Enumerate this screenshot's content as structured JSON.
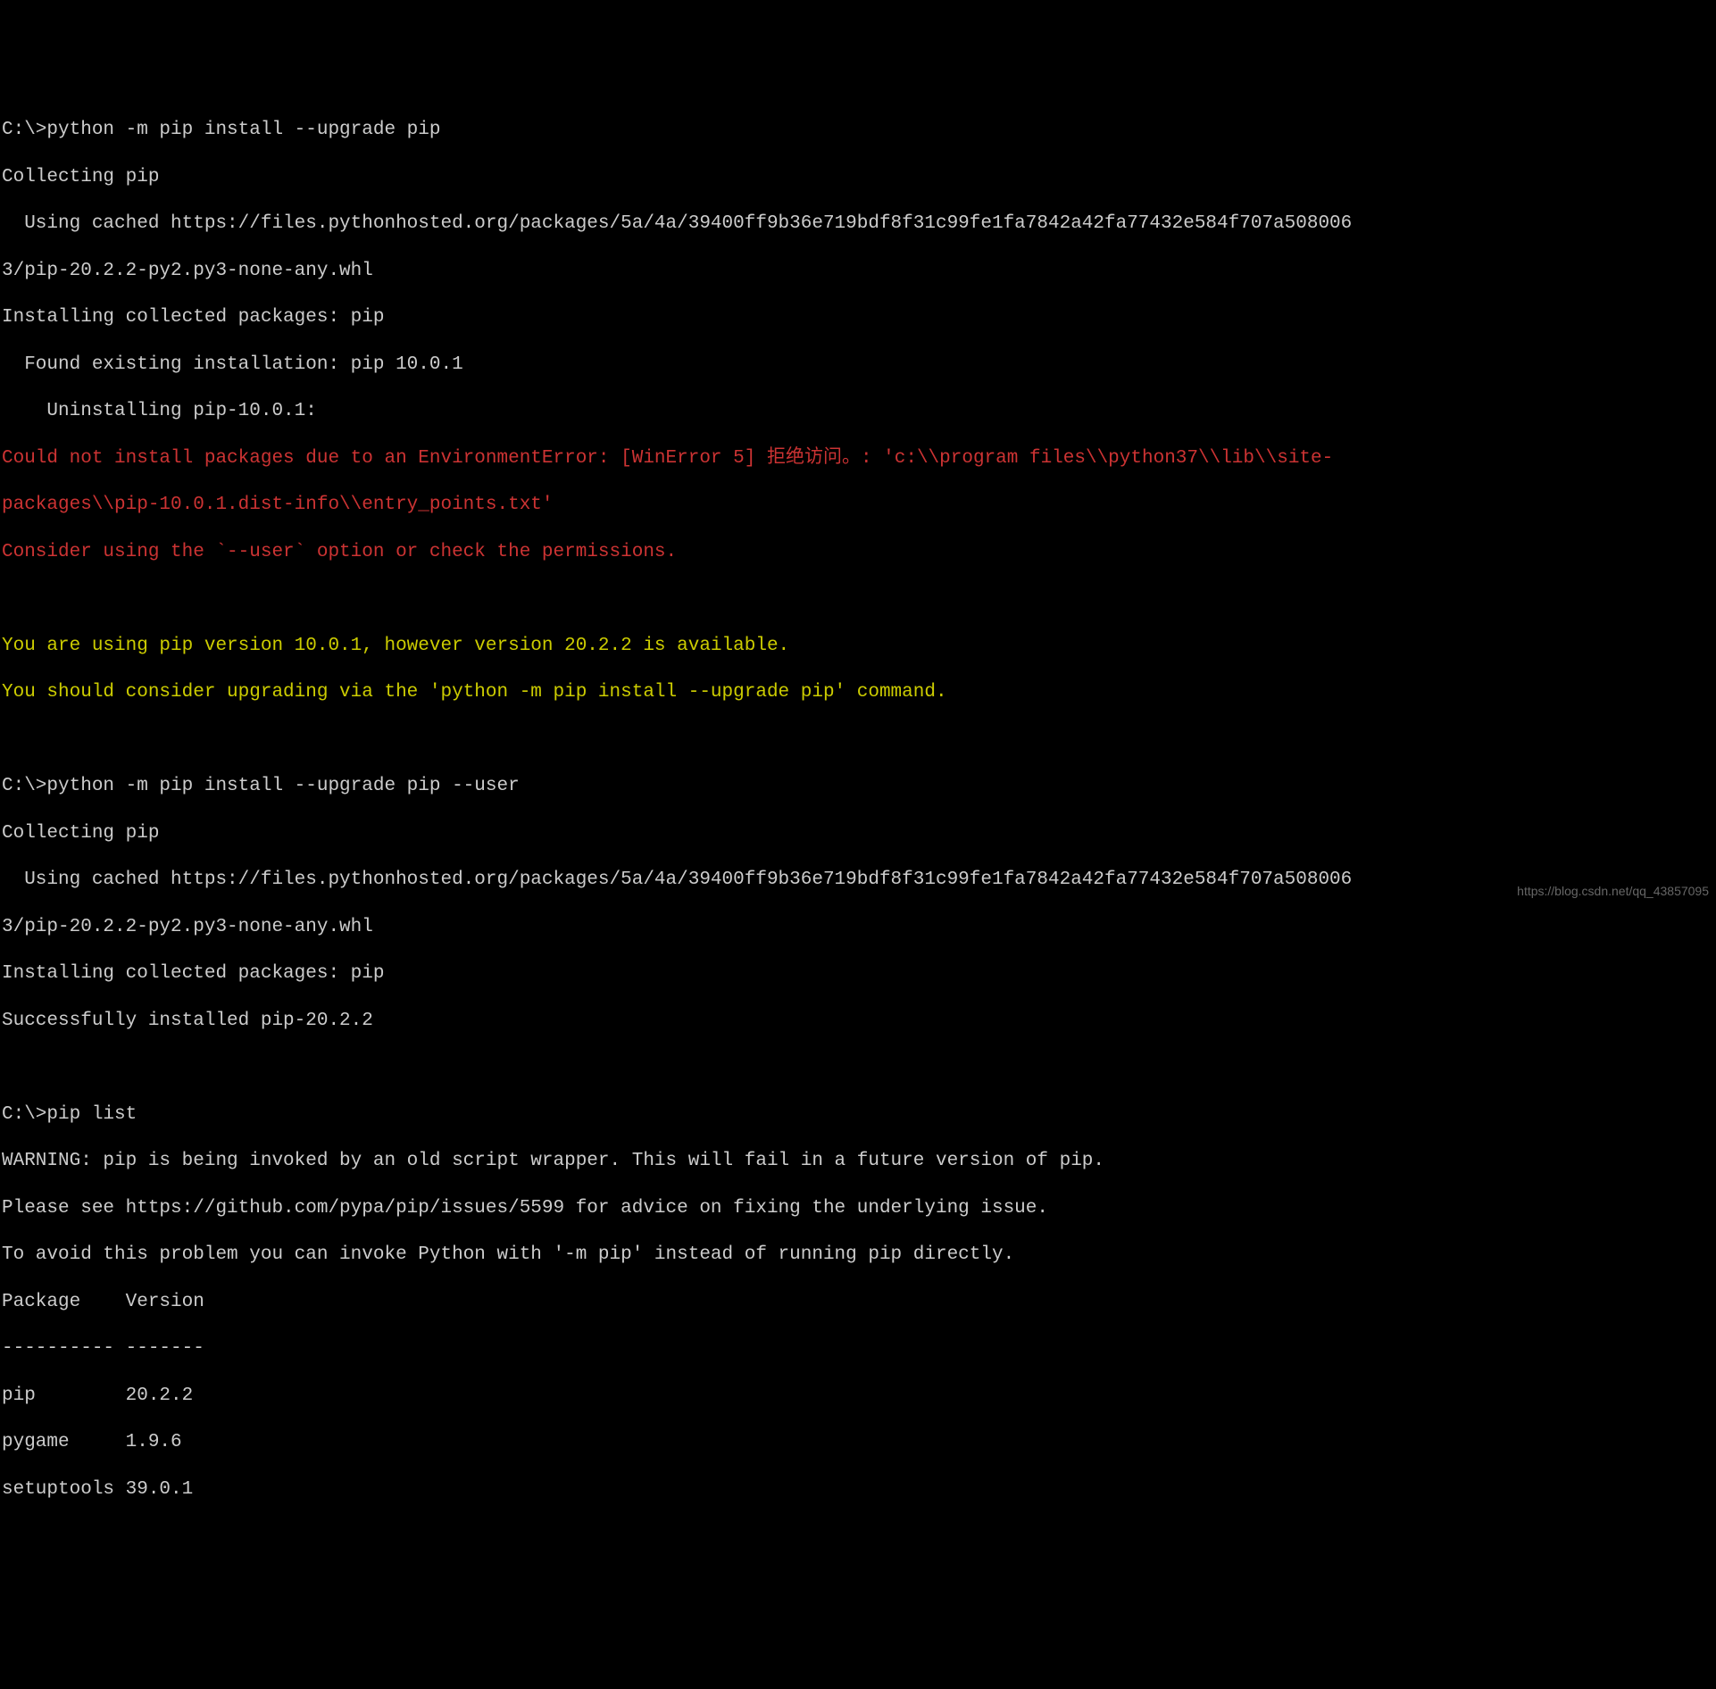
{
  "lines": {
    "l1": "C:\\>python -m pip install --upgrade pip",
    "l2": "Collecting pip",
    "l3": "  Using cached https://files.pythonhosted.org/packages/5a/4a/39400ff9b36e719bdf8f31c99fe1fa7842a42fa77432e584f707a508006",
    "l4": "3/pip-20.2.2-py2.py3-none-any.whl",
    "l5": "Installing collected packages: pip",
    "l6": "  Found existing installation: pip 10.0.1",
    "l7": "    Uninstalling pip-10.0.1:",
    "l8": "Could not install packages due to an EnvironmentError: [WinError 5] 拒绝访问。: 'c:\\\\program files\\\\python37\\\\lib\\\\site-",
    "l9": "packages\\\\pip-10.0.1.dist-info\\\\entry_points.txt'",
    "l10": "Consider using the `--user` option or check the permissions.",
    "l11": "",
    "l12": "You are using pip version 10.0.1, however version 20.2.2 is available.",
    "l13": "You should consider upgrading via the 'python -m pip install --upgrade pip' command.",
    "l14": "",
    "l15": "C:\\>python -m pip install --upgrade pip --user",
    "l16": "Collecting pip",
    "l17": "  Using cached https://files.pythonhosted.org/packages/5a/4a/39400ff9b36e719bdf8f31c99fe1fa7842a42fa77432e584f707a508006",
    "l18": "3/pip-20.2.2-py2.py3-none-any.whl",
    "l19": "Installing collected packages: pip",
    "l20": "Successfully installed pip-20.2.2",
    "l21": "",
    "l22": "C:\\>pip list",
    "l23": "WARNING: pip is being invoked by an old script wrapper. This will fail in a future version of pip.",
    "l24": "Please see https://github.com/pypa/pip/issues/5599 for advice on fixing the underlying issue.",
    "l25": "To avoid this problem you can invoke Python with '-m pip' instead of running pip directly.",
    "l26": "Package    Version",
    "l27": "---------- -------",
    "l28": "pip        20.2.2",
    "l29": "pygame     1.9.6",
    "l30": "setuptools 39.0.1"
  },
  "watermark": "https://blog.csdn.net/qq_43857095"
}
